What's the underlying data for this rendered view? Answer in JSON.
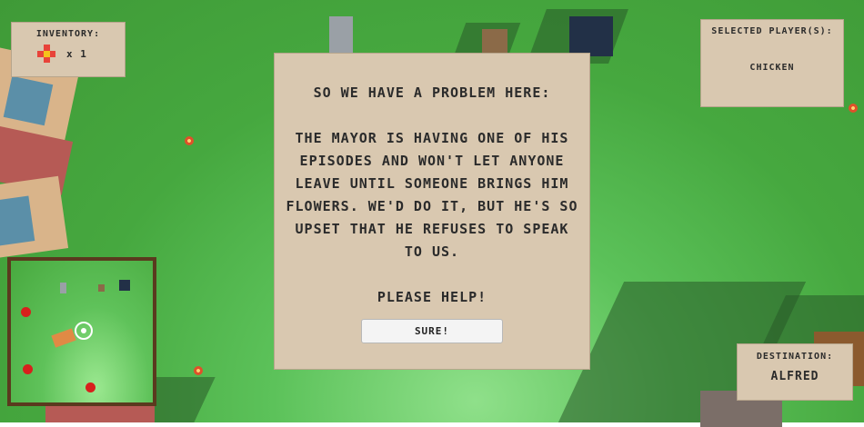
{
  "inventory": {
    "title": "INVENTORY:",
    "items": [
      {
        "icon": "health-cross-icon",
        "count": "x 1"
      }
    ]
  },
  "selected_players": {
    "title": "SELECTED PLAYER(S):",
    "names": [
      "CHICKEN"
    ]
  },
  "dialog": {
    "heading": "SO WE HAVE A PROBLEM HERE:",
    "body": "THE MAYOR IS HAVING ONE OF HIS EPISODES AND WON'T LET ANYONE LEAVE UNTIL SOMEONE BRINGS HIM FLOWERS. WE'D DO IT, BUT HE'S SO UPSET THAT HE REFUSES TO SPEAK TO US.",
    "plea": "PLEASE HELP!",
    "button_label": "SURE!"
  },
  "destination": {
    "title": "DESTINATION:",
    "name": "ALFRED"
  },
  "minimap": {
    "player_marker": "player-location-icon",
    "flower_markers": 4
  },
  "colors": {
    "panel": "#d9c8b0",
    "grass": "#46a83f",
    "minimap_frame": "#5a3a1e",
    "marker": "#d8201c"
  }
}
